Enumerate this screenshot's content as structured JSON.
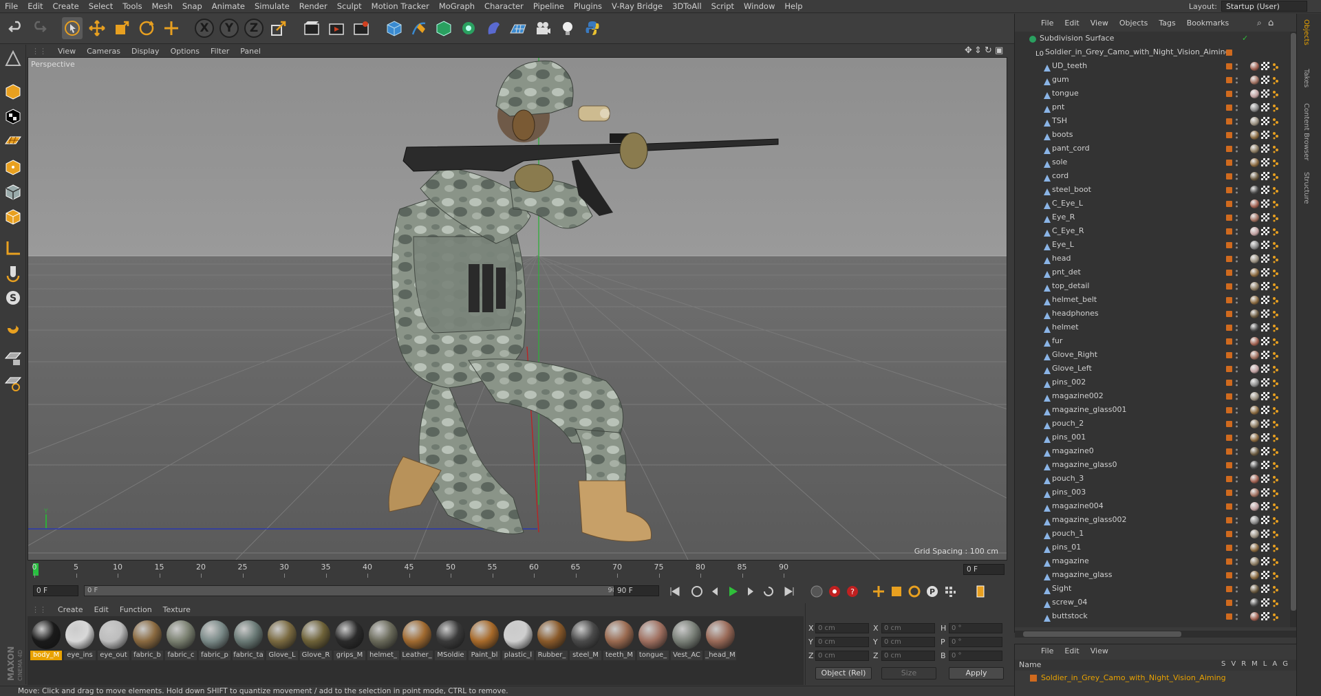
{
  "menu": [
    "File",
    "Edit",
    "Create",
    "Select",
    "Tools",
    "Mesh",
    "Snap",
    "Animate",
    "Simulate",
    "Render",
    "Sculpt",
    "Motion Tracker",
    "MoGraph",
    "Character",
    "Pipeline",
    "Plugins",
    "V-Ray Bridge",
    "3DToAll",
    "Script",
    "Window",
    "Help"
  ],
  "layout": {
    "label": "Layout:",
    "value": "Startup (User)"
  },
  "viewport": {
    "menu": [
      "View",
      "Cameras",
      "Display",
      "Options",
      "Filter",
      "Panel"
    ],
    "label": "Perspective",
    "grid_spacing": "Grid Spacing : 100 cm"
  },
  "timeline": {
    "ticks": [
      "0",
      "5",
      "10",
      "15",
      "20",
      "25",
      "30",
      "35",
      "40",
      "45",
      "50",
      "55",
      "60",
      "65",
      "70",
      "75",
      "80",
      "85",
      "90"
    ],
    "current_frame": "0 F"
  },
  "playback": {
    "start": "0 F",
    "range_start": "0 F",
    "range_end": "90 F",
    "end": "90 F"
  },
  "material_manager": {
    "menu": [
      "Create",
      "Edit",
      "Function",
      "Texture"
    ],
    "materials": [
      {
        "name": "body_M",
        "color": "#1a1a1a",
        "selected": true
      },
      {
        "name": "eye_ins",
        "color": "#d8d8d8"
      },
      {
        "name": "eye_out",
        "color": "#bdbdbd"
      },
      {
        "name": "fabric_b",
        "color": "#8a6a40"
      },
      {
        "name": "fabric_c",
        "color": "#7a8070"
      },
      {
        "name": "fabric_p",
        "color": "#7a8a88"
      },
      {
        "name": "fabric_ta",
        "color": "#6a7a76"
      },
      {
        "name": "Glove_L",
        "color": "#7a6a40"
      },
      {
        "name": "Glove_R",
        "color": "#6e6238"
      },
      {
        "name": "grips_M",
        "color": "#2a2a2a"
      },
      {
        "name": "helmet_",
        "color": "#6a6a5a"
      },
      {
        "name": "Leather_",
        "color": "#a06a30"
      },
      {
        "name": "MSoldie",
        "color": "#3a3a3a"
      },
      {
        "name": "Paint_bl",
        "color": "#a86a2a"
      },
      {
        "name": "plastic_l",
        "color": "#cfcfcf"
      },
      {
        "name": "Rubber_",
        "color": "#8a5a2a"
      },
      {
        "name": "steel_M",
        "color": "#4a4a4a"
      },
      {
        "name": "teeth_M",
        "color": "#9a6a50"
      },
      {
        "name": "tongue_",
        "color": "#a07060"
      },
      {
        "name": "Vest_AC",
        "color": "#7a8078"
      },
      {
        "name": "_head_M",
        "color": "#9a6a58"
      }
    ]
  },
  "coords": {
    "row_labels": [
      "X",
      "Y",
      "Z"
    ],
    "pos": [
      "0 cm",
      "0 cm",
      "0 cm"
    ],
    "size": [
      "0 cm",
      "0 cm",
      "0 cm"
    ],
    "rot_labels": [
      "H",
      "P",
      "B"
    ],
    "rot": [
      "0 °",
      "0 °",
      "0 °"
    ],
    "mode": "Object (Rel)",
    "size_mode": "Size",
    "apply": "Apply"
  },
  "status": "Move: Click and drag to move elements. Hold down SHIFT to quantize movement / add to the selection in point mode, CTRL to remove.",
  "objects": {
    "menu": [
      "File",
      "Edit",
      "View",
      "Objects",
      "Tags",
      "Bookmarks"
    ],
    "root": "Subdivision Surface",
    "group": "Soldier_in_Grey_Camo_with_Night_Vision_Aiming",
    "items": [
      "UD_teeth",
      "gum",
      "tongue",
      "pnt",
      "TSH",
      "boots",
      "pant_cord",
      "sole",
      "cord",
      "steel_boot",
      "C_Eye_L",
      "Eye_R",
      "C_Eye_R",
      "Eye_L",
      "head",
      "pnt_det",
      "top_detail",
      "helmet_belt",
      "headphones",
      "helmet",
      "fur",
      "Glove_Right",
      "Glove_Left",
      "pins_002",
      "magazine002",
      "magazine_glass001",
      "pouch_2",
      "pins_001",
      "magazine0",
      "magazine_glass0",
      "pouch_3",
      "pins_003",
      "magazine004",
      "magazine_glass002",
      "pouch_1",
      "pins_01",
      "magazine",
      "magazine_glass",
      "Sight",
      "screw_04",
      "buttstock"
    ]
  },
  "layers": {
    "menu": [
      "File",
      "Edit",
      "View"
    ],
    "header_name": "Name",
    "cols": [
      "S",
      "V",
      "R",
      "M",
      "L",
      "A",
      "G"
    ],
    "row": "Soldier_in_Grey_Camo_with_Night_Vision_Aiming"
  },
  "side_tabs": [
    "Objects",
    "Takes",
    "Content Browser",
    "Structure"
  ],
  "colors": {
    "accent": "#e9a200",
    "tag_orange": "#d06a1e",
    "selection_text": "#e9a200"
  }
}
